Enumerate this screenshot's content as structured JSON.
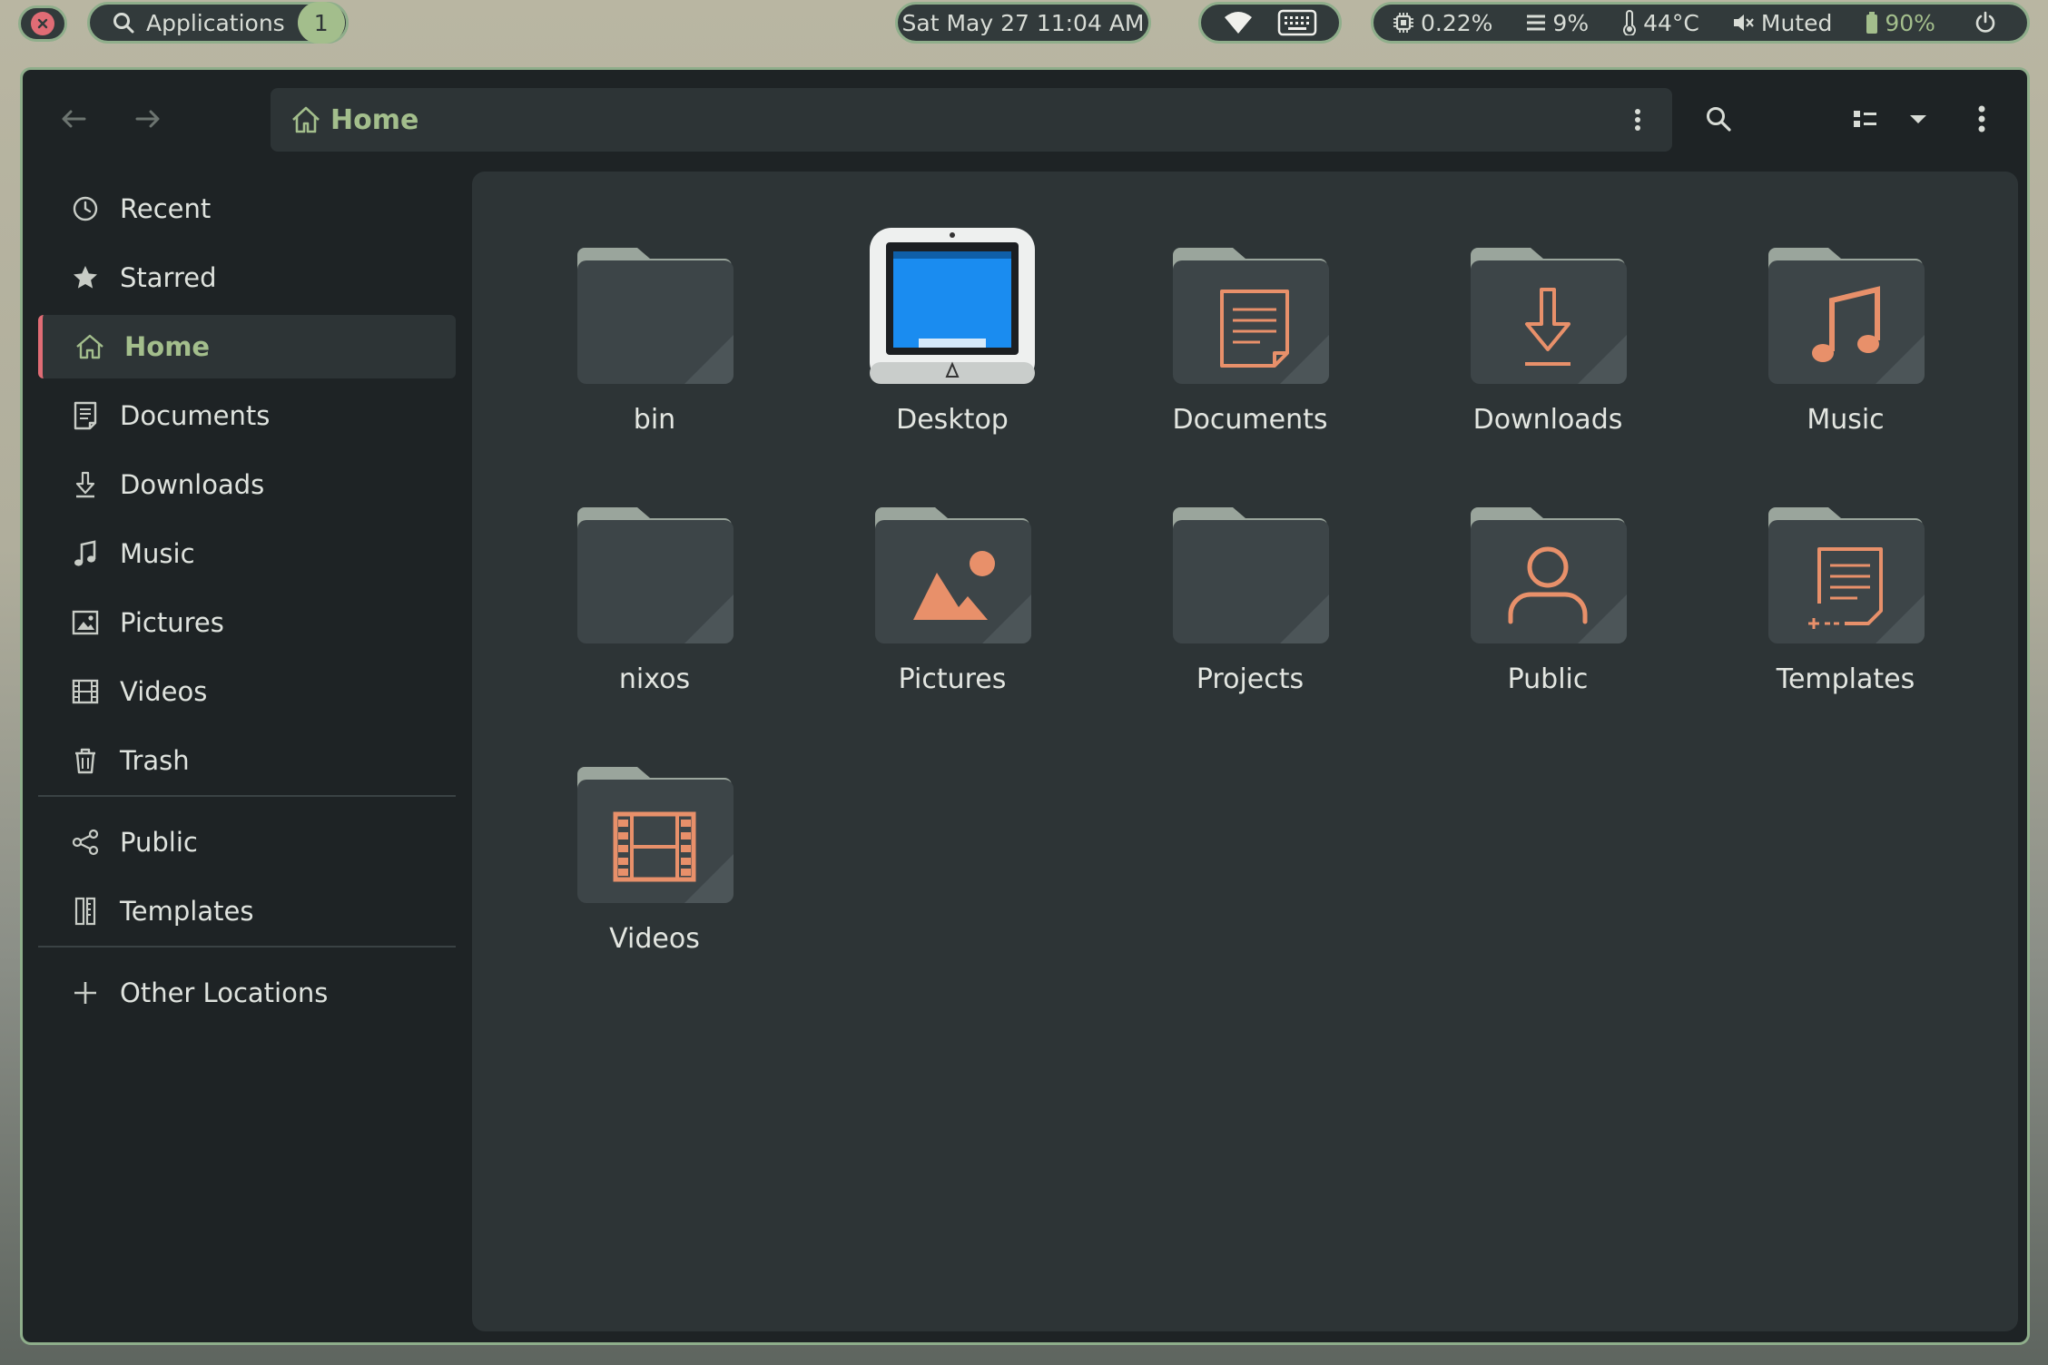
{
  "topbar": {
    "launcher_label": "Applications",
    "workspace_number": "1",
    "clock": "Sat May 27 11:04 AM",
    "cpu": "0.22%",
    "memory": "9%",
    "temperature": "44°C",
    "volume": "Muted",
    "battery": "90%"
  },
  "headerbar": {
    "path_label": "Home"
  },
  "sidebar": {
    "items": [
      {
        "label": "Recent",
        "icon": "clock-icon"
      },
      {
        "label": "Starred",
        "icon": "star-icon"
      },
      {
        "label": "Home",
        "icon": "home-icon",
        "active": true
      },
      {
        "label": "Documents",
        "icon": "document-icon"
      },
      {
        "label": "Downloads",
        "icon": "download-icon"
      },
      {
        "label": "Music",
        "icon": "music-note-icon"
      },
      {
        "label": "Pictures",
        "icon": "image-icon"
      },
      {
        "label": "Videos",
        "icon": "film-icon"
      },
      {
        "label": "Trash",
        "icon": "trash-icon"
      }
    ],
    "bookmarks": [
      {
        "label": "Public",
        "icon": "share-icon"
      },
      {
        "label": "Templates",
        "icon": "template-icon"
      }
    ],
    "other_locations": "Other Locations"
  },
  "files": [
    {
      "name": "bin",
      "icon": "folder-icon"
    },
    {
      "name": "Desktop",
      "icon": "desktop-monitor-icon"
    },
    {
      "name": "Documents",
      "icon": "folder-documents-icon"
    },
    {
      "name": "Downloads",
      "icon": "folder-download-icon"
    },
    {
      "name": "Music",
      "icon": "folder-music-icon"
    },
    {
      "name": "nixos",
      "icon": "folder-icon"
    },
    {
      "name": "Pictures",
      "icon": "folder-pictures-icon"
    },
    {
      "name": "Projects",
      "icon": "folder-icon"
    },
    {
      "name": "Public",
      "icon": "folder-public-icon"
    },
    {
      "name": "Templates",
      "icon": "folder-templates-icon"
    },
    {
      "name": "Videos",
      "icon": "folder-videos-icon"
    }
  ],
  "colors": {
    "accent_green": "#a3be8c",
    "accent_red": "#e06c75",
    "folder_emblem": "#e8906a",
    "folder_body": "#3d4548",
    "folder_tab": "#9aa59c"
  }
}
